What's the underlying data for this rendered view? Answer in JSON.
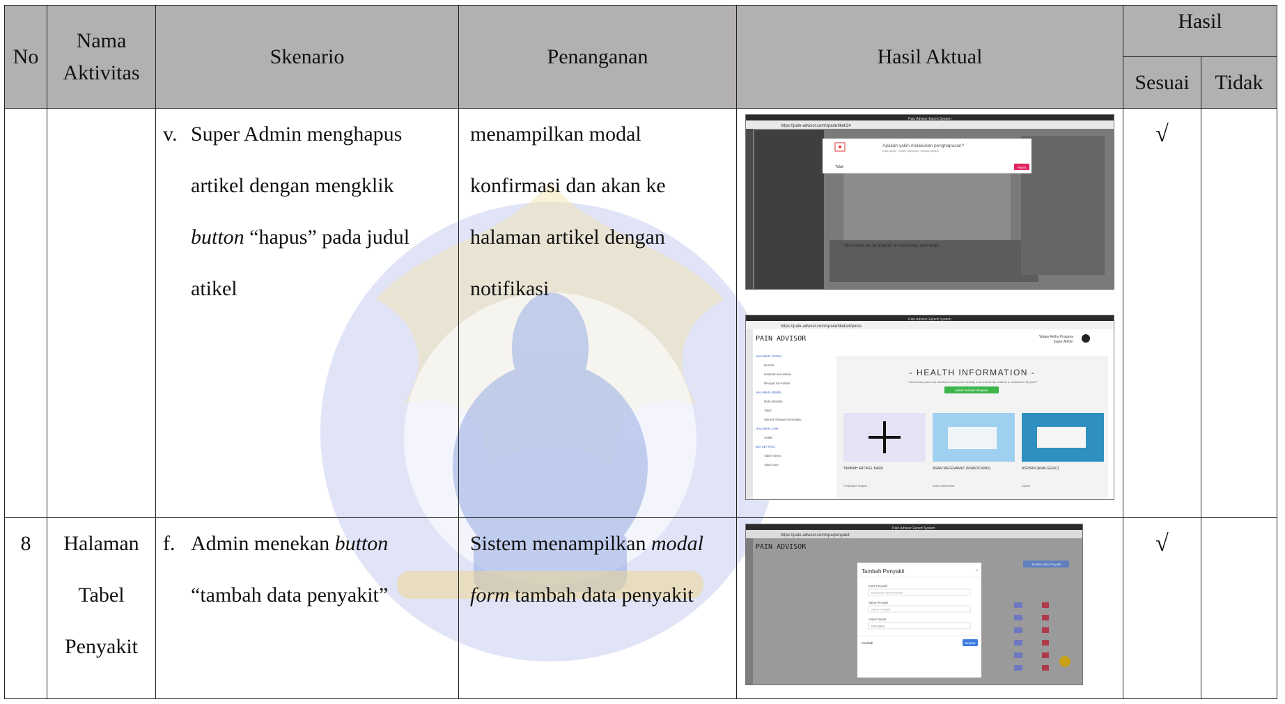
{
  "table": {
    "headers": {
      "no": "No",
      "aktivitas_line1": "Nama",
      "aktivitas_line2": "Aktivitas",
      "skenario": "Skenario",
      "penanganan": "Penanganan",
      "hasil_aktual": "Hasil Aktual",
      "hasil": "Hasil",
      "sesuai": "Sesuai",
      "tidak": "Tidak"
    },
    "rows": [
      {
        "no": "",
        "aktivitas": "",
        "marker": "v.",
        "skenario_lines": [
          "Super Admin menghapus",
          "artikel dengan mengklik",
          "button “hapus” pada judul",
          "atikel"
        ],
        "penanganan_lines": [
          "menampilkan modal",
          "konfirmasi dan akan ke",
          "halaman artikel dengan",
          "notifikasi"
        ],
        "screenshots": [
          "modal-konfirmasi-hapus-screenshot",
          "halaman-artikel-screenshot"
        ],
        "sesuai": "√",
        "tidak": ""
      },
      {
        "no": "8",
        "aktivitas_lines": [
          "Halaman",
          "Tabel",
          "Penyakit"
        ],
        "marker": "f.",
        "skenario_lines": [
          "Admin menekan button",
          "“tambah data penyakit”"
        ],
        "penanganan_lines": [
          "Sistem menampilkan modal",
          "form tambah data penyakit"
        ],
        "screenshots": [
          "modal-tambah-penyakit-screenshot"
        ],
        "sesuai": "√",
        "tidak": ""
      }
    ]
  },
  "screens": {
    "s1": {
      "browser_title": "Pain Advisor Expert System",
      "url": "https://pain-advisor.com/spa/artikel/24",
      "modal_title": "Apakah yakin melakukan penghapusan?",
      "modal_sub": "Data dipilih : Testing Blackbox Stunting artikel",
      "btn_cancel": "Tidak",
      "btn_ok": "Hapus",
      "article_title": "TESTING BLACKBOX STUNTING ARTIKEL"
    },
    "s2": {
      "browser_title": "Pain Advisor Expert System",
      "url": "https://pain-advisor.com/spa/artikel/all/posts",
      "logo": "PAIN ADVISOR",
      "user_name": "Wajan Ardha Pratama",
      "user_role": "Super Admin",
      "heading": "- HEALTH INFORMATION -",
      "quote": "\" Just because you're not sick doesn't mean you're healthy, so let food be thy medicine or medicine be thy food \"",
      "alert": "artikel berhasil dihapus!",
      "sidebar": [
        "HALAMAN UTAMA",
        "Rumah",
        "Halaman Konsultasi",
        "Riwayat Konsultasi",
        "HALAMAN ADMIN",
        "Data Aktivitas",
        "Tabel",
        "Seluruh Riwayat Konsultasi",
        "HALAMAN LAIN",
        "Artikel",
        "BIG SETTING",
        "Tabel Admin",
        "Tabel User"
      ],
      "cards": [
        {
          "title": "TAMBAH ARTIKEL BARU",
          "text": "Penjelasan singkat"
        },
        {
          "title": "ASAM MEFENAMAT (NSAID/OAINS)",
          "text": "Asam mefenamat"
        },
        {
          "title": "ASPIRIN (ANALGESIC)",
          "text": "Aspirin"
        }
      ]
    },
    "s3": {
      "browser_title": "Pain Advisor Expert System",
      "url": "https://pain-advisor.com/spa/penyakit",
      "logo": "PAIN ADVISOR",
      "modal_title": "Tambah Penyakit",
      "fields": [
        {
          "label": "Kode Penyakit",
          "placeholder": "Masukkan Kode Penyakit"
        },
        {
          "label": "Nama Penyakit",
          "placeholder": "Nama Penyakit"
        },
        {
          "label": "Artikel Terkait",
          "placeholder": "Pilih Artikel"
        }
      ],
      "btn_cancel": "Kembali",
      "btn_save": "Simpan",
      "add_button": "Tambah Data Penyakit"
    }
  }
}
